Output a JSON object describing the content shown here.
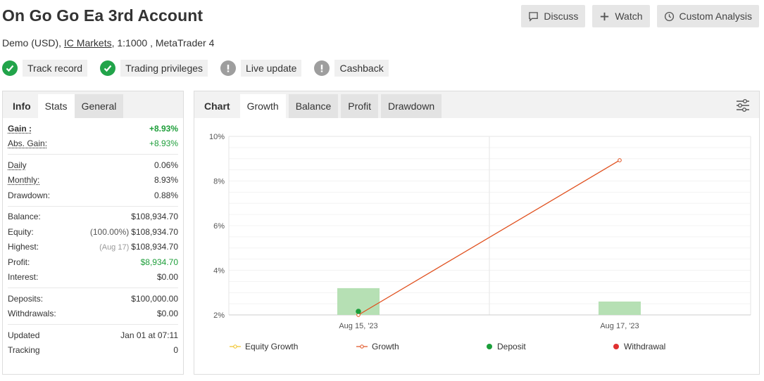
{
  "header": {
    "title": "On Go Go Ea 3rd Account",
    "subtitle_prefix": "Demo (USD),",
    "broker_link": "IC Markets",
    "subtitle_suffix": ", 1:1000 , MetaTrader 4"
  },
  "actions": {
    "discuss": "Discuss",
    "watch": "Watch",
    "custom_analysis": "Custom Analysis"
  },
  "badges": [
    {
      "label": "Track record",
      "status": "ok"
    },
    {
      "label": "Trading privileges",
      "status": "ok"
    },
    {
      "label": "Live update",
      "status": "warn"
    },
    {
      "label": "Cashback",
      "status": "warn"
    }
  ],
  "left_tabs": {
    "header": "Info",
    "stats": "Stats",
    "general": "General"
  },
  "stats": {
    "gain": {
      "label": "Gain :",
      "value": "+8.93%"
    },
    "abs_gain": {
      "label": "Abs. Gain:",
      "value": "+8.93%"
    },
    "daily": {
      "label": "Daily",
      "value": "0.06%"
    },
    "monthly": {
      "label": "Monthly:",
      "value": "8.93%"
    },
    "drawdown": {
      "label": "Drawdown:",
      "value": "0.88%"
    },
    "balance": {
      "label": "Balance:",
      "value": "$108,934.70"
    },
    "equity": {
      "label": "Equity:",
      "note": "(100.00%)",
      "value": "$108,934.70"
    },
    "highest": {
      "label": "Highest:",
      "note": "(Aug 17)",
      "value": "$108,934.70"
    },
    "profit": {
      "label": "Profit:",
      "value": "$8,934.70"
    },
    "interest": {
      "label": "Interest:",
      "value": "$0.00"
    },
    "deposits": {
      "label": "Deposits:",
      "value": "$100,000.00"
    },
    "withdrawals": {
      "label": "Withdrawals:",
      "value": "$0.00"
    },
    "updated": {
      "label": "Updated",
      "value": "Jan 01 at 07:11"
    },
    "tracking": {
      "label": "Tracking",
      "value": "0"
    }
  },
  "chart_tabs": {
    "header": "Chart",
    "growth": "Growth",
    "balance": "Balance",
    "profit": "Profit",
    "drawdown": "Drawdown"
  },
  "colors": {
    "growth_line": "#e0501e",
    "equity_growth": "#f0c020",
    "deposit": "#1a9e3a",
    "withdrawal": "#e03030",
    "bar_fill": "#b6e0b4"
  },
  "chart_data": {
    "type": "line",
    "x_categories": [
      "Aug 15, '23",
      "Aug 17, '23"
    ],
    "y_ticks": [
      "10%",
      "8%",
      "6%",
      "4%",
      "2%"
    ],
    "ylim": [
      2,
      10
    ],
    "series": [
      {
        "name": "Equity Growth",
        "values": []
      },
      {
        "name": "Growth",
        "values": [
          0,
          8.93
        ]
      }
    ],
    "bars": [
      3.2,
      2.6
    ],
    "deposits_at": [
      "Aug 15, '23"
    ],
    "legend": [
      "Equity Growth",
      "Growth",
      "Deposit",
      "Withdrawal"
    ]
  }
}
